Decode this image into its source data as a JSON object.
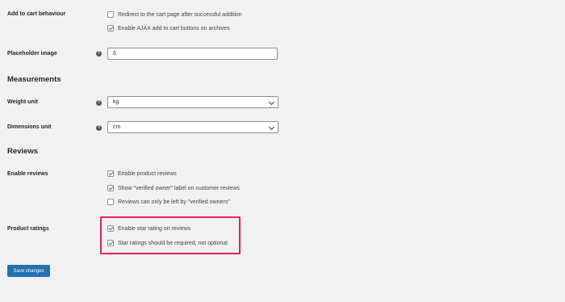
{
  "add_to_cart": {
    "label": "Add to cart behaviour",
    "options": [
      {
        "text": "Redirect to the cart page after successful addition",
        "checked": false
      },
      {
        "text": "Enable AJAX add to cart buttons on archives",
        "checked": true
      }
    ]
  },
  "placeholder_image": {
    "label": "Placeholder image",
    "help_icon": "question-icon",
    "value": "6"
  },
  "measurements": {
    "heading": "Measurements",
    "weight_unit": {
      "label": "Weight unit",
      "help_icon": "question-icon",
      "value": "kg"
    },
    "dimensions_unit": {
      "label": "Dimensions unit",
      "help_icon": "question-icon",
      "value": "cm"
    }
  },
  "reviews": {
    "heading": "Reviews",
    "enable_reviews": {
      "label": "Enable reviews",
      "options": [
        {
          "text": "Enable product reviews",
          "checked": true
        },
        {
          "text": "Show \"verified owner\" label on customer reviews",
          "checked": true
        },
        {
          "text": "Reviews can only be left by \"verified owners\"",
          "checked": false
        }
      ]
    },
    "product_ratings": {
      "label": "Product ratings",
      "options": [
        {
          "text": "Enable star rating on reviews",
          "checked": true
        },
        {
          "text": "Star ratings should be required, not optional",
          "checked": true
        }
      ]
    }
  },
  "save_button": {
    "label": "Save changes"
  },
  "colors": {
    "accent": "#2271b1",
    "highlight": "#e0245e",
    "background": "#f1f1f1"
  }
}
